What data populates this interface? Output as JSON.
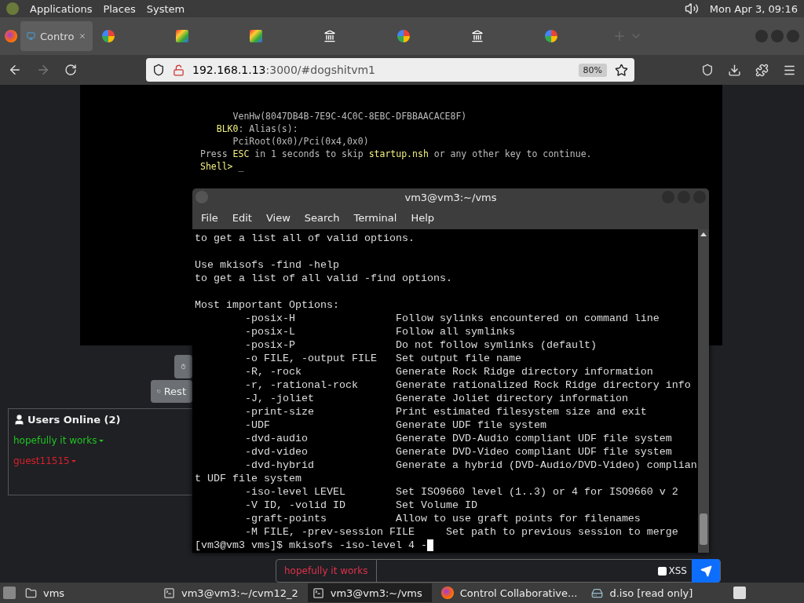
{
  "top_panel": {
    "menus": [
      "Applications",
      "Places",
      "System"
    ],
    "clock": "Mon Apr  3, 09:16"
  },
  "browser": {
    "tabs": [
      {
        "kind": "monitor",
        "label": "Contro",
        "selected": true
      },
      {
        "kind": "google",
        "selected": false
      },
      {
        "kind": "ba",
        "selected": false
      },
      {
        "kind": "ba",
        "selected": false
      },
      {
        "kind": "building",
        "selected": false
      },
      {
        "kind": "google",
        "selected": false
      },
      {
        "kind": "building",
        "selected": false
      },
      {
        "kind": "google",
        "selected": false
      }
    ],
    "url": {
      "host": "192.168.1.13",
      "rest": ":3000/#dogshitvm1"
    },
    "zoom": "80%"
  },
  "vm_screen": {
    "lines": [
      [
        {
          "text": "      VenHw(8047DB4B-7E9C-4C0C-8EBC-DFBBAACACE8F)",
          "highlight": false
        }
      ],
      [
        {
          "text": "   BLK0",
          "highlight": true
        },
        {
          "text": ": Alias(s):",
          "highlight": false
        }
      ],
      [
        {
          "text": "      PciRoot(0x0)/Pci(0x4,0x0)",
          "highlight": false
        }
      ],
      [
        {
          "text": "Press ",
          "highlight": false
        },
        {
          "text": "ESC",
          "highlight": true
        },
        {
          "text": " in 1 seconds to skip ",
          "highlight": false
        },
        {
          "text": "startup.nsh",
          "highlight": true
        },
        {
          "text": " or any other key to continue.",
          "highlight": false
        }
      ],
      [
        {
          "text": "Shell> ",
          "highlight": true
        },
        {
          "text": "_",
          "highlight": false
        }
      ]
    ]
  },
  "vm_controls": {
    "restart": "Rest"
  },
  "users_panel": {
    "title": "Users Online (2)",
    "users": [
      {
        "name": "hopefully it works",
        "color": "#22c322"
      },
      {
        "name": "guest11515",
        "color": "#d8202a"
      }
    ]
  },
  "chat": {
    "username": "hopefully it works",
    "xss": {
      "label": "XSS",
      "checked": false
    }
  },
  "terminal": {
    "title": "vm3@vm3:~/vms",
    "menu": [
      "File",
      "Edit",
      "View",
      "Search",
      "Terminal",
      "Help"
    ],
    "paragraphs": [
      [
        "to get a list all of valid options."
      ],
      [
        "Use mkisofs -find -help",
        "to get a list of all valid -find options."
      ],
      [
        "Most important Options:",
        "        -posix-H                Follow sylinks encountered on command line",
        "        -posix-L                Follow all symlinks",
        "        -posix-P                Do not follow symlinks (default)",
        "        -o FILE, -output FILE   Set output file name",
        "        -R, -rock               Generate Rock Ridge directory information",
        "        -r, -rational-rock      Generate rationalized Rock Ridge directory info",
        "        -J, -joliet             Generate Joliet directory information",
        "        -print-size             Print estimated filesystem size and exit",
        "        -UDF                    Generate UDF file system",
        "        -dvd-audio              Generate DVD-Audio compliant UDF file system",
        "        -dvd-video              Generate DVD-Video compliant UDF file system",
        "        -dvd-hybrid             Generate a hybrid (DVD-Audio/DVD-Video) complian",
        "t UDF file system",
        "        -iso-level LEVEL        Set ISO9660 level (1..3) or 4 for ISO9660 v 2",
        "        -V ID, -volid ID        Set Volume ID",
        "        -graft-points           Allow to use graft points for filenames",
        "        -M FILE, -prev-session FILE     Set path to previous session to merge"
      ]
    ],
    "prompt": "[vm3@vm3 vms]$ mkisofs -iso-level 4 -"
  },
  "taskbar": {
    "items": [
      {
        "kind": "folder",
        "label": "vms",
        "selected": false
      },
      {
        "kind": "terminal",
        "label": "vm3@vm3:~/cvm12_2",
        "selected": false
      },
      {
        "kind": "terminal",
        "label": "vm3@vm3:~/vms",
        "selected": true
      },
      {
        "kind": "firefox",
        "label": "Control Collaborative...",
        "selected": false
      },
      {
        "kind": "disk",
        "label": "d.iso [read only]",
        "selected": false
      }
    ]
  }
}
